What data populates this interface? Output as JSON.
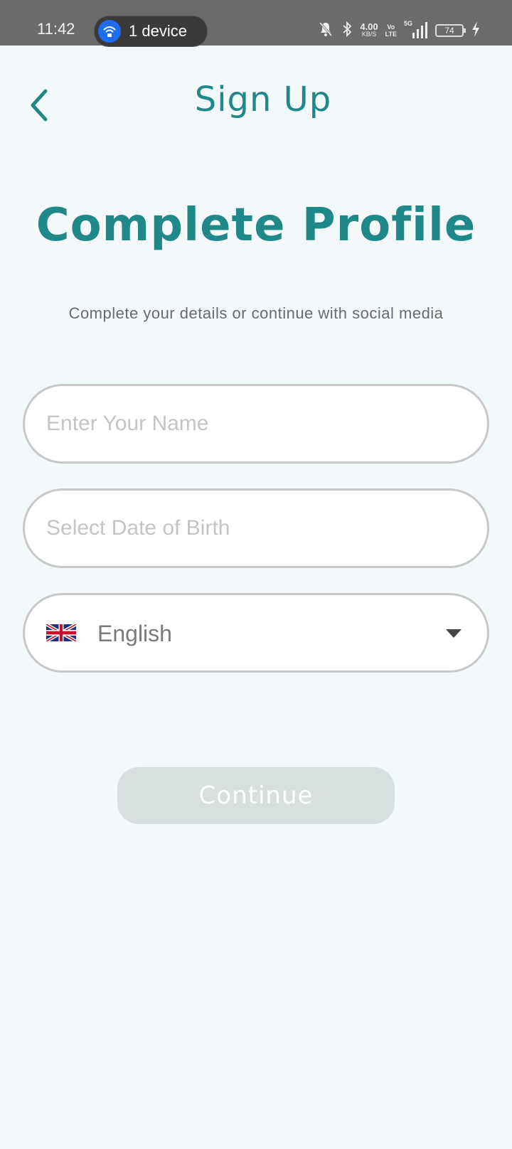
{
  "status_bar": {
    "time": "11:42",
    "device_label": "1 device",
    "speed_value": "4.00",
    "speed_unit": "KB/S",
    "volte_top": "Vo",
    "volte_bottom": "LTE",
    "network_label": "5G",
    "battery_level": "74",
    "icons": [
      "wifi-icon",
      "mute-bell-icon",
      "bluetooth-icon",
      "signal-icon",
      "battery-icon",
      "charging-icon"
    ]
  },
  "header": {
    "title": "Sign Up",
    "back_icon": "chevron-left-icon"
  },
  "main": {
    "title": "Complete Profile",
    "subtitle": "Complete your details or continue with social media"
  },
  "form": {
    "name_placeholder": "Enter Your Name",
    "name_value": "",
    "dob_placeholder": "Select Date of Birth",
    "dob_value": "",
    "language_value": "English",
    "language_flag": "uk-flag-icon"
  },
  "actions": {
    "continue_label": "Continue"
  },
  "colors": {
    "accent": "#21888a",
    "background": "#f3f9fb",
    "button_disabled": "#d8dfdf"
  }
}
